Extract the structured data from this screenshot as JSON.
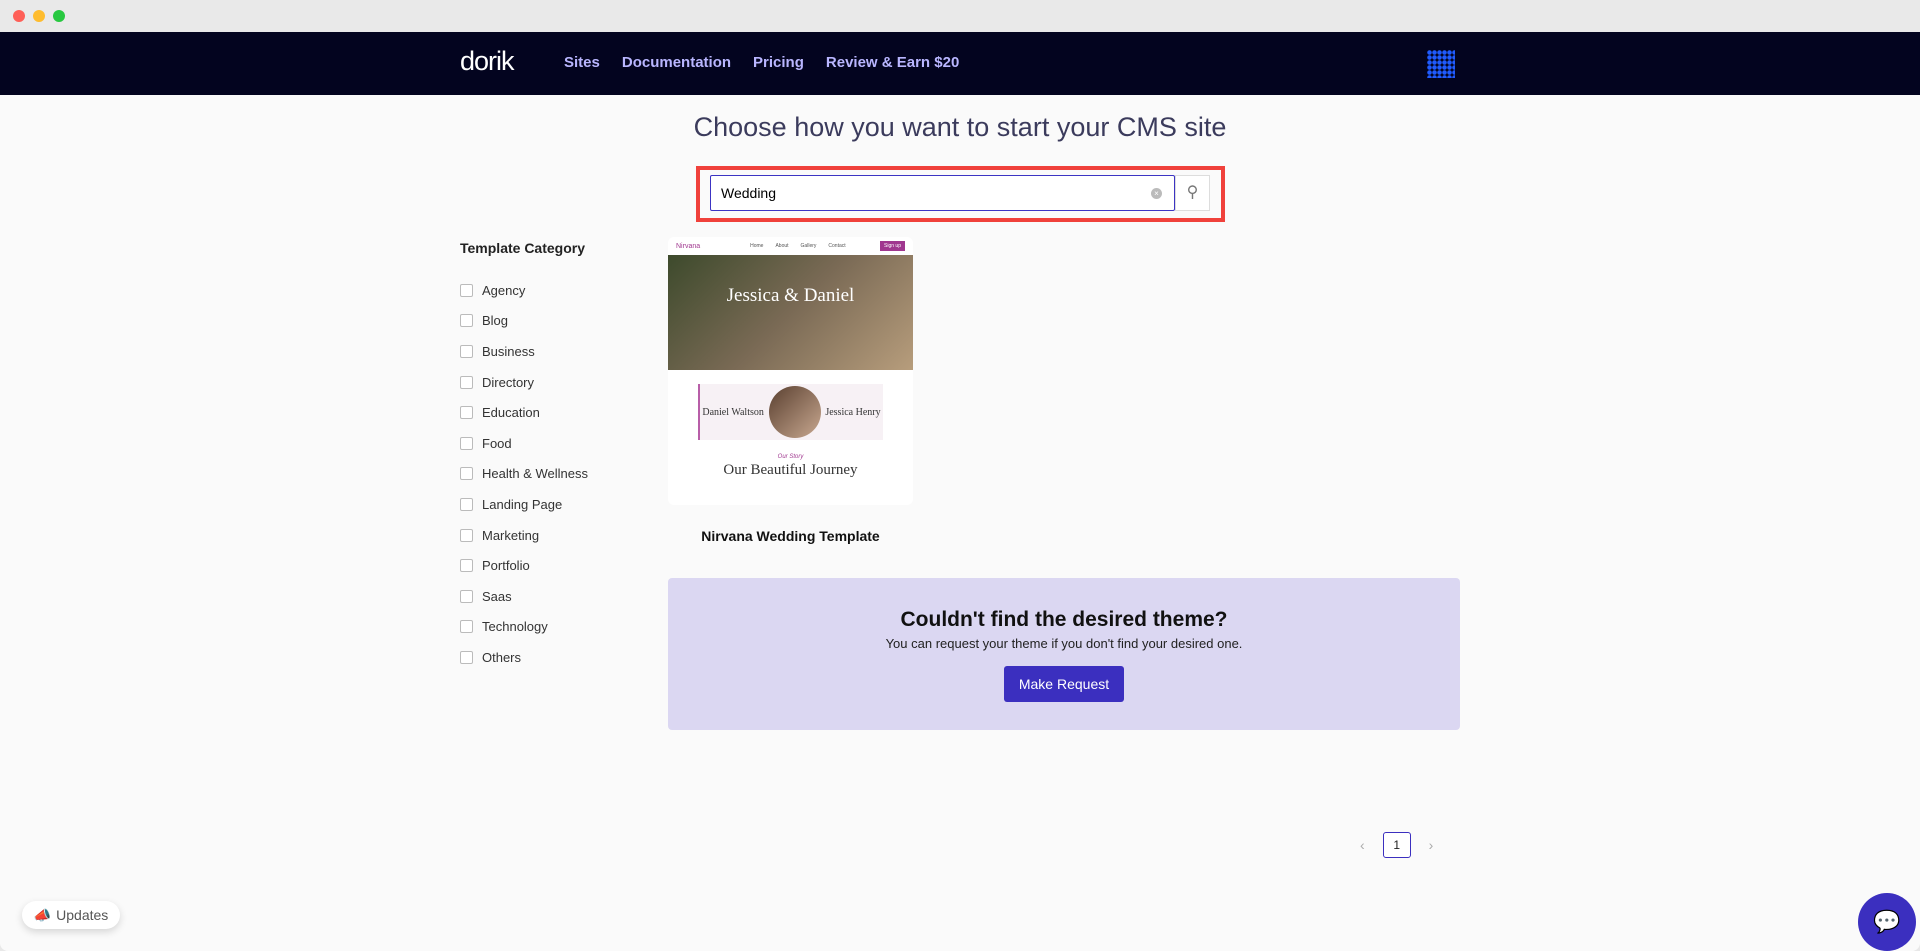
{
  "nav": {
    "logo": "dorik",
    "links": [
      "Sites",
      "Documentation",
      "Pricing",
      "Review & Earn $20"
    ]
  },
  "page_title": "Choose how you want to start your CMS site",
  "search": {
    "value": "Wedding",
    "clear_icon": "clear-circle-icon",
    "button_icon": "search-icon"
  },
  "sidebar": {
    "title": "Template Category",
    "categories": [
      "Agency",
      "Blog",
      "Business",
      "Directory",
      "Education",
      "Food",
      "Health & Wellness",
      "Landing Page",
      "Marketing",
      "Portfolio",
      "Saas",
      "Technology",
      "Others"
    ]
  },
  "templates": [
    {
      "name": "Nirvana Wedding Template",
      "preview": {
        "brand": "Nirvana",
        "nav": [
          "Home",
          "About",
          "Gallery",
          "Contact"
        ],
        "cta": "Sign up",
        "hero_title": "Jessica & Daniel",
        "groom": "Daniel Waltson",
        "bride": "Jessica Henry",
        "section_title": "Our Beautiful Journey",
        "section_kicker": "Our Story"
      }
    }
  ],
  "request": {
    "title": "Couldn't find the desired theme?",
    "subtitle": "You can request your theme if you don't find your desired one.",
    "button": "Make Request"
  },
  "pagination": {
    "current": "1",
    "prev": "‹",
    "next": "›"
  },
  "updates_button": "Updates",
  "colors": {
    "nav_bg": "#03041f",
    "accent": "#3b2fbf",
    "highlight": "#f0413b",
    "request_bg": "#dbd7f2"
  }
}
